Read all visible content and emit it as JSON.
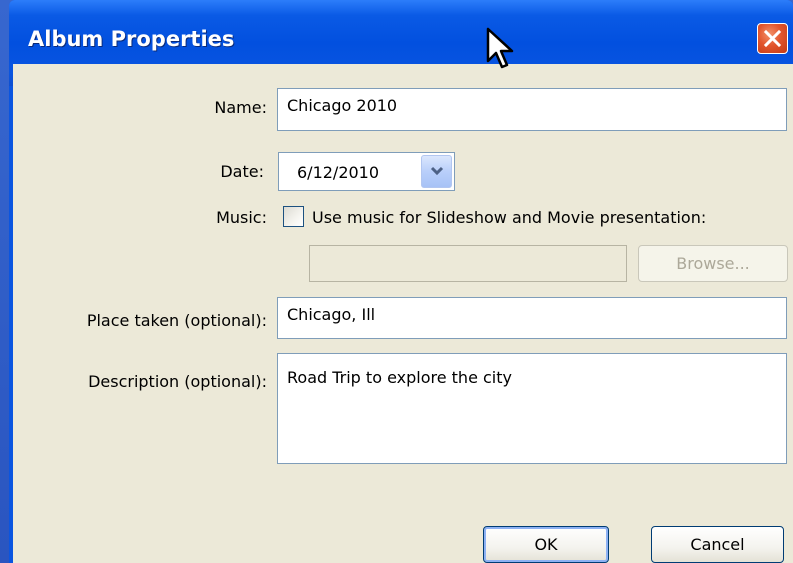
{
  "dialog": {
    "title": "Album Properties",
    "close_icon": "close-icon"
  },
  "form": {
    "name_label": "Name:",
    "name_value": "Chicago 2010",
    "date_label": "Date:",
    "date_value": "6/12/2010",
    "music_label": "Music:",
    "music_checkbox_label": "Use music for Slideshow and Movie presentation:",
    "music_checked": false,
    "music_path_value": "",
    "browse_label": "Browse...",
    "place_label": "Place taken (optional):",
    "place_value": "Chicago, Ill",
    "description_label": "Description (optional):",
    "description_value": "Road Trip to explore the city"
  },
  "buttons": {
    "ok_label": "OK",
    "cancel_label": "Cancel"
  },
  "colors": {
    "titlebar": "#0a55e0",
    "client_bg": "#ece9d8",
    "close_button": "#e2552d"
  }
}
